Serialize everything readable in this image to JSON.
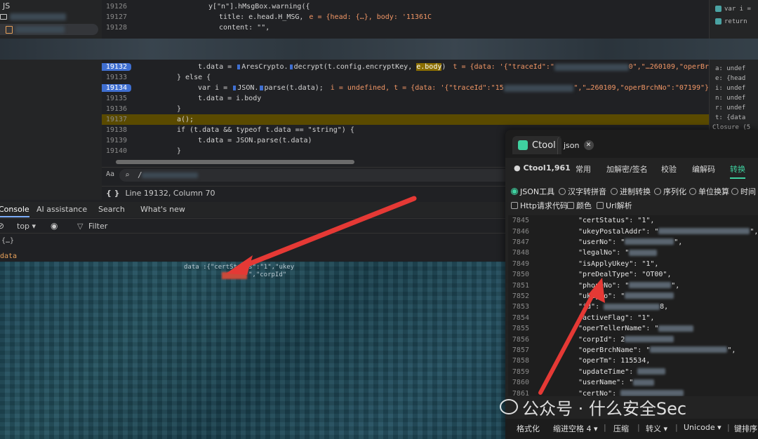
{
  "file_tree": {
    "folder_label": "JS"
  },
  "editor": {
    "lines": [
      {
        "n": "19126",
        "bp": false
      },
      {
        "n": "19127",
        "bp": false
      },
      {
        "n": "19128",
        "bp": false
      },
      {
        "n": "19132",
        "bp": true
      },
      {
        "n": "19133",
        "bp": false
      },
      {
        "n": "19134",
        "bp": true
      },
      {
        "n": "19135",
        "bp": false
      },
      {
        "n": "19136",
        "bp": false
      },
      {
        "n": "19137",
        "bp": false
      },
      {
        "n": "19138",
        "bp": false
      },
      {
        "n": "19139",
        "bp": false
      },
      {
        "n": "19140",
        "bp": false
      }
    ],
    "code": {
      "l19126": "y[\"n\"].hMsgBox.warning({",
      "l19127a": "title: e.head.H_MSG,",
      "l19127b": "e = {head: {…}, body: '11361C",
      "l19128": "content: \"\",",
      "l19132a": "t.data = ",
      "l19132b": "AresCrypto.",
      "l19132c": "decrypt(t.config.encryptKey, ",
      "l19132d": "e.body",
      "l19132e": ")",
      "l19132f": "t = {data: '{\"traceId\":\"",
      "l19132g": "0\",\"…260109,\"operBr",
      "l19133": "} else {",
      "l19134a": "var i = ",
      "l19134b": "JSON.",
      "l19134c": "parse(t.data);",
      "l19134d": "i = undefined, t = {data: '{\"traceId\":\"15",
      "l19134e": "\",\"…260109,\"operBrchNo\":\"07199\"}",
      "l19135": "t.data = i.body",
      "l19136": "}",
      "l19137": "a();",
      "l19138": "if (t.data && typeof t.data == \"string\") {",
      "l19139": "t.data = JSON.parse(t.data)",
      "l19140": "}"
    },
    "search_placeholder": "/",
    "status": "Line 19132, Column 70",
    "search_case_label": "Aa"
  },
  "scope": {
    "rows": [
      "var i =",
      "return",
      "a: undef",
      "e: {head",
      "i: undef",
      "n: undef",
      "r: undef",
      "t: {data",
      "Closure (5"
    ]
  },
  "console": {
    "tabs": [
      "Console",
      "AI assistance",
      "Search",
      "What's new"
    ],
    "context": "top",
    "filter_placeholder": "Filter",
    "row_collapsed": "{…}",
    "row_data": "data",
    "snippet": "data :{\"certStatus\":\"1\",\"ukey",
    "snippet2": "\",\"corpId\""
  },
  "ctool": {
    "title": "Ctool",
    "tab2": "json",
    "nav": [
      "Ctool",
      "1,961",
      "常用",
      "加解密/签名",
      "校验",
      "编解码",
      "转换"
    ],
    "radios": [
      "JSON工具",
      "汉字转拼音",
      "进制转换",
      "序列化",
      "单位换算",
      "时间",
      "Http请求代码",
      "颜色",
      "Url解析"
    ],
    "json_lines": [
      {
        "n": "7845",
        "key": "\"certStatus\"",
        "val": "\"1\","
      },
      {
        "n": "7846",
        "key": "\"ukeyPostalAddr\"",
        "val": "\"",
        "blur": 130,
        "tail": "\","
      },
      {
        "n": "7847",
        "key": "\"userNo\"",
        "val": "\"",
        "blur": 70,
        "tail": "\","
      },
      {
        "n": "7848",
        "key": "\"legalNo\"",
        "val": "\"",
        "blur": 40,
        "tail": ""
      },
      {
        "n": "7849",
        "key": "\"isApplyUkey\"",
        "val": "\"1\","
      },
      {
        "n": "7850",
        "key": "\"preDealType\"",
        "val": "\"OT00\","
      },
      {
        "n": "7851",
        "key": "\"phoneNo\"",
        "val": "\"",
        "blur": 60,
        "tail": "\","
      },
      {
        "n": "7852",
        "key": "\"ukeyNo\"",
        "val": "\"",
        "blur": 70,
        "tail": ""
      },
      {
        "n": "7853",
        "key": "\"id\"",
        "val": "",
        "blur": 80,
        "tail": "8,"
      },
      {
        "n": "7854",
        "key": "\"activeFlag\"",
        "val": "\"1\","
      },
      {
        "n": "7855",
        "key": "\"operTellerName\"",
        "val": "\"",
        "blur": 50,
        "tail": ""
      },
      {
        "n": "7856",
        "key": "\"corpId\"",
        "val": "2",
        "blur": 70,
        "tail": ""
      },
      {
        "n": "7857",
        "key": "\"operBrchName\"",
        "val": "\"",
        "blur": 110,
        "tail": "\","
      },
      {
        "n": "7858",
        "key": "\"operTm\"",
        "val": "115534,"
      },
      {
        "n": "7859",
        "key": "\"updateTime\"",
        "val": "",
        "blur": 40,
        "tail": ""
      },
      {
        "n": "7860",
        "key": "\"userName\"",
        "val": "\"",
        "blur": 30,
        "tail": ""
      },
      {
        "n": "7861",
        "key": "\"certNo\"",
        "val": "",
        "blur": 90,
        "tail": ""
      }
    ],
    "bottom": [
      "格式化",
      "缩进空格 4",
      "压缩",
      "转义",
      "Unicode",
      "键排序"
    ]
  },
  "watermark": "公众号 · 什么安全Sec",
  "colors": {
    "accent": "#3fd1a0",
    "breakpoint": "#3f6fd1",
    "arrow": "#e53935"
  }
}
